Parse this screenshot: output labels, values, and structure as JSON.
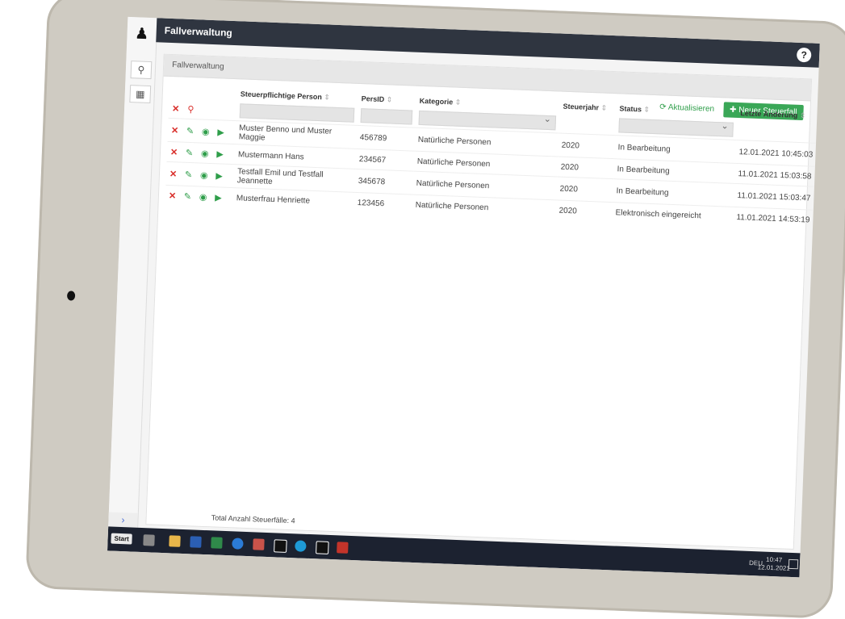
{
  "app": {
    "title": "Fallverwaltung",
    "breadcrumb": "Fallverwaltung",
    "help_icon": "?"
  },
  "actions": {
    "refresh_label": "Aktualisieren",
    "new_label": "Neuer Steuerfall"
  },
  "table": {
    "headers": {
      "person": "Steuerpflichtige Person",
      "persid": "PersID",
      "kategorie": "Kategorie",
      "steuerjahr": "Steuerjahr",
      "status": "Status",
      "aenderung": "Letzte Änderung"
    },
    "rows": [
      {
        "person": "Muster Benno und Muster Maggie",
        "persid": "456789",
        "kategorie": "Natürliche Personen",
        "steuerjahr": "2020",
        "status": "In Bearbeitung",
        "aenderung": "12.01.2021 10:45:03"
      },
      {
        "person": "Mustermann Hans",
        "persid": "234567",
        "kategorie": "Natürliche Personen",
        "steuerjahr": "2020",
        "status": "In Bearbeitung",
        "aenderung": "11.01.2021 15:03:58"
      },
      {
        "person": "Testfall Emil und Testfall Jeannette",
        "persid": "345678",
        "kategorie": "Natürliche Personen",
        "steuerjahr": "2020",
        "status": "In Bearbeitung",
        "aenderung": "11.01.2021 15:03:47"
      },
      {
        "person": "Musterfrau Henriette",
        "persid": "123456",
        "kategorie": "Natürliche Personen",
        "steuerjahr": "2020",
        "status": "Elektronisch eingereicht",
        "aenderung": "11.01.2021 14:53:19"
      }
    ]
  },
  "footer": {
    "total": "Total Anzahl Steuerfälle: 4"
  },
  "taskbar": {
    "start": "Start",
    "lang": "DEU",
    "time": "10:47",
    "date": "12.01.2021"
  },
  "colors": {
    "header_bg": "#2f3540",
    "accent_green": "#3aa757",
    "delete_red": "#d9302c"
  }
}
